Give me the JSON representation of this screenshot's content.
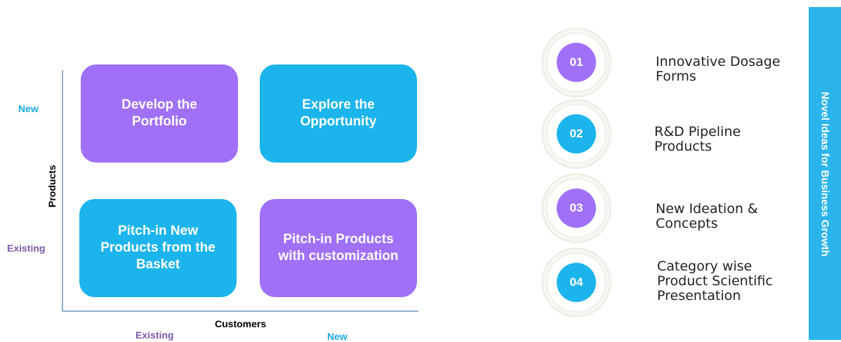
{
  "matrix": {
    "row_labels": {
      "new": "New",
      "existing": "Existing"
    },
    "axis_titles": {
      "y": "Products",
      "x": "Customers"
    },
    "column_labels": {
      "existing": "Existing",
      "new": "New"
    },
    "quadrants": [
      {
        "text": "Develop the Portfolio",
        "color": "#a070f9"
      },
      {
        "text": "Explore the Opportunity",
        "color": "#1cb4ec"
      },
      {
        "text": "Pitch-in New Products from the Basket",
        "color": "#1cb4ec"
      },
      {
        "text": "Pitch-in Products with customization",
        "color": "#a070f9"
      }
    ]
  },
  "steps": [
    {
      "number": "01",
      "text": "Innovative Dosage Forms",
      "color": "#a070f9"
    },
    {
      "number": "02",
      "text": "R&D Pipeline Products",
      "color": "#1cb4ec"
    },
    {
      "number": "03",
      "text": "New Ideation & Concepts",
      "color": "#a070f9"
    },
    {
      "number": "04",
      "text": "Category wise Product Scientific Presentation",
      "color": "#1cb4ec"
    }
  ],
  "banner": {
    "title": "Novel Ideas for Business Growth",
    "color": "#2bb4ec"
  }
}
